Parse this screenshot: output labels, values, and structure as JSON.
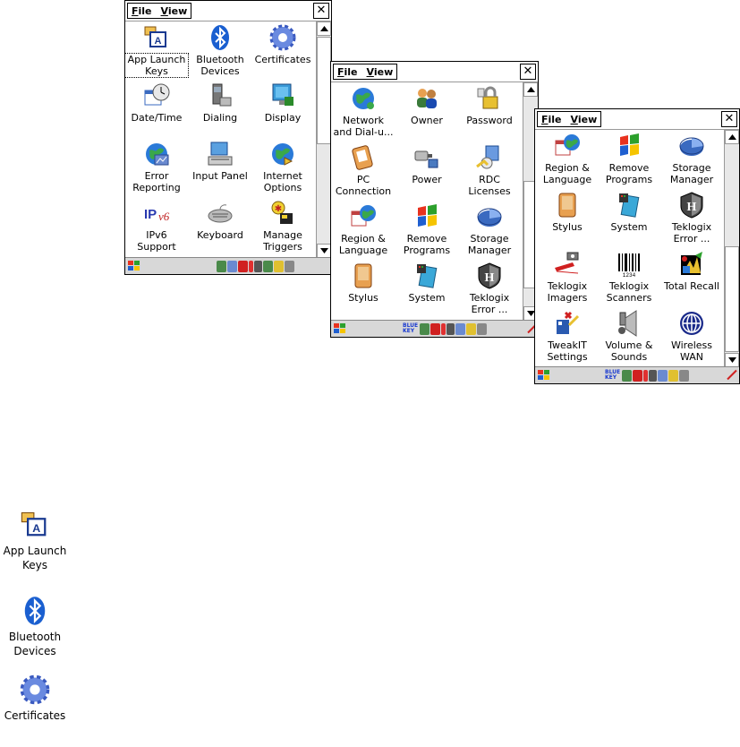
{
  "menu": {
    "file": "File",
    "view": "View",
    "close": "✕"
  },
  "win1": {
    "items": [
      {
        "label": "App Launch Keys",
        "l1": "App Launch",
        "l2": "Keys",
        "icon": "app-launch-keys-icon"
      },
      {
        "label": "Bluetooth Devices",
        "l1": "Bluetooth",
        "l2": "Devices",
        "icon": "bluetooth-icon"
      },
      {
        "label": "Certificates",
        "l1": "Certificates",
        "l2": "",
        "icon": "certificates-icon"
      },
      {
        "label": "Date/Time",
        "l1": "Date/Time",
        "l2": "",
        "icon": "date-time-icon"
      },
      {
        "label": "Dialing",
        "l1": "Dialing",
        "l2": "",
        "icon": "dialing-icon"
      },
      {
        "label": "Display",
        "l1": "Display",
        "l2": "",
        "icon": "display-icon"
      },
      {
        "label": "Error Reporting",
        "l1": "Error",
        "l2": "Reporting",
        "icon": "error-reporting-icon"
      },
      {
        "label": "Input Panel",
        "l1": "Input Panel",
        "l2": "",
        "icon": "input-panel-icon"
      },
      {
        "label": "Internet Options",
        "l1": "Internet",
        "l2": "Options",
        "icon": "internet-options-icon"
      },
      {
        "label": "IPv6 Support",
        "l1": "IPv6",
        "l2": "Support",
        "icon": "ipv6-icon"
      },
      {
        "label": "Keyboard",
        "l1": "Keyboard",
        "l2": "",
        "icon": "keyboard-icon"
      },
      {
        "label": "Manage Triggers",
        "l1": "Manage",
        "l2": "Triggers",
        "icon": "manage-triggers-icon"
      }
    ]
  },
  "win2": {
    "items": [
      {
        "l1": "Network",
        "l2": "and Dial-u...",
        "icon": "network-icon"
      },
      {
        "l1": "Owner",
        "l2": "",
        "icon": "owner-icon"
      },
      {
        "l1": "Password",
        "l2": "",
        "icon": "password-icon"
      },
      {
        "l1": "PC",
        "l2": "Connection",
        "icon": "pc-connection-icon"
      },
      {
        "l1": "Power",
        "l2": "",
        "icon": "power-icon"
      },
      {
        "l1": "RDC",
        "l2": "Licenses",
        "icon": "rdc-licenses-icon"
      },
      {
        "l1": "Region &",
        "l2": "Language",
        "icon": "region-language-icon"
      },
      {
        "l1": "Remove",
        "l2": "Programs",
        "icon": "remove-programs-icon"
      },
      {
        "l1": "Storage",
        "l2": "Manager",
        "icon": "storage-manager-icon"
      },
      {
        "l1": "Stylus",
        "l2": "",
        "icon": "stylus-icon"
      },
      {
        "l1": "System",
        "l2": "",
        "icon": "system-icon"
      },
      {
        "l1": "Teklogix",
        "l2": "Error ...",
        "icon": "teklogix-error-icon"
      }
    ]
  },
  "win3": {
    "items": [
      {
        "l1": "Region &",
        "l2": "Language",
        "icon": "region-language-icon"
      },
      {
        "l1": "Remove",
        "l2": "Programs",
        "icon": "remove-programs-icon"
      },
      {
        "l1": "Storage",
        "l2": "Manager",
        "icon": "storage-manager-icon"
      },
      {
        "l1": "Stylus",
        "l2": "",
        "icon": "stylus-icon"
      },
      {
        "l1": "System",
        "l2": "",
        "icon": "system-icon"
      },
      {
        "l1": "Teklogix",
        "l2": "Error ...",
        "icon": "teklogix-error-icon"
      },
      {
        "l1": "Teklogix",
        "l2": "Imagers",
        "icon": "teklogix-imagers-icon"
      },
      {
        "l1": "Teklogix",
        "l2": "Scanners",
        "icon": "teklogix-scanners-icon"
      },
      {
        "l1": "Total Recall",
        "l2": "",
        "icon": "total-recall-icon"
      },
      {
        "l1": "TweakIT",
        "l2": "Settings",
        "icon": "tweakit-icon"
      },
      {
        "l1": "Volume &",
        "l2": "Sounds",
        "icon": "volume-sounds-icon"
      },
      {
        "l1": "Wireless",
        "l2": "WAN",
        "icon": "wireless-wan-icon"
      }
    ]
  },
  "taskbar": {
    "blue_key": "BLUE KEY"
  },
  "legend": [
    {
      "l1": "App Launch",
      "l2": "Keys",
      "icon": "app-launch-keys-icon"
    },
    {
      "l1": "Bluetooth",
      "l2": "Devices",
      "icon": "bluetooth-icon"
    },
    {
      "l1": "Certificates",
      "l2": "",
      "icon": "certificates-icon"
    }
  ],
  "colors": {
    "accent": "#1a5fd0",
    "taskbar": "#d8d8d8",
    "border": "#000000"
  }
}
